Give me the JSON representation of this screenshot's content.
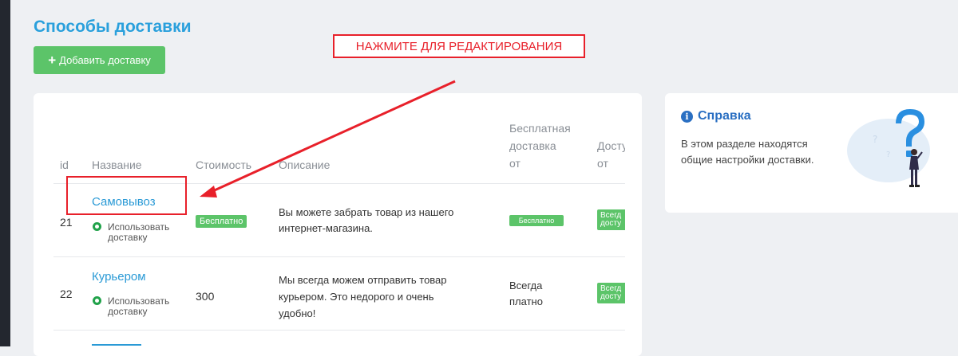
{
  "page": {
    "title": "Способы доставки"
  },
  "toolbar": {
    "add_label": "Добавить доставку"
  },
  "annotation": {
    "callout": "НАЖМИТЕ ДЛЯ РЕДАКТИРОВАНИЯ"
  },
  "table": {
    "headers": {
      "id": "id",
      "name": "Название",
      "cost": "Стоимость",
      "description": "Описание",
      "free_from": "Бесплатная доставка от",
      "free_from_lines": [
        "Бесплатная",
        "доставка",
        "от"
      ],
      "available_from_lines": [
        "Досту",
        "от"
      ]
    },
    "rows": [
      {
        "id": "21",
        "name": "Самовывоз",
        "use_label": "Использовать доставку",
        "use_lines": [
          "Использовать",
          "доставку"
        ],
        "cost": "Бесплатно",
        "description": "Вы можете забрать товар из нашего интернет-магазина.",
        "desc_lines": [
          "Вы можете забрать товар из нашего",
          "интернет-магазина."
        ],
        "free_from": "Бесплатно",
        "available_from_lines": [
          "Всегд",
          "досту"
        ]
      },
      {
        "id": "22",
        "name": "Курьером",
        "use_label": "Использовать доставку",
        "use_lines": [
          "Использовать",
          "доставку"
        ],
        "cost": "300",
        "description": "Мы всегда можем отправить товар курьером. Это недорого и очень удобно!",
        "desc_lines": [
          "Мы всегда можем отправить товар",
          "курьером. Это недорого и очень",
          "удобно!"
        ],
        "free_from_lines": [
          "Всегда",
          "платно"
        ],
        "available_from_lines": [
          "Всегд",
          "досту"
        ]
      }
    ]
  },
  "help": {
    "title": "Справка",
    "text_lines": [
      "В этом разделе находятся",
      "общие настройки доставки."
    ]
  },
  "colors": {
    "accent": "#2aa0dc",
    "success": "#5cc469",
    "annotation": "#e8202a",
    "help_title": "#2a6fc2"
  }
}
